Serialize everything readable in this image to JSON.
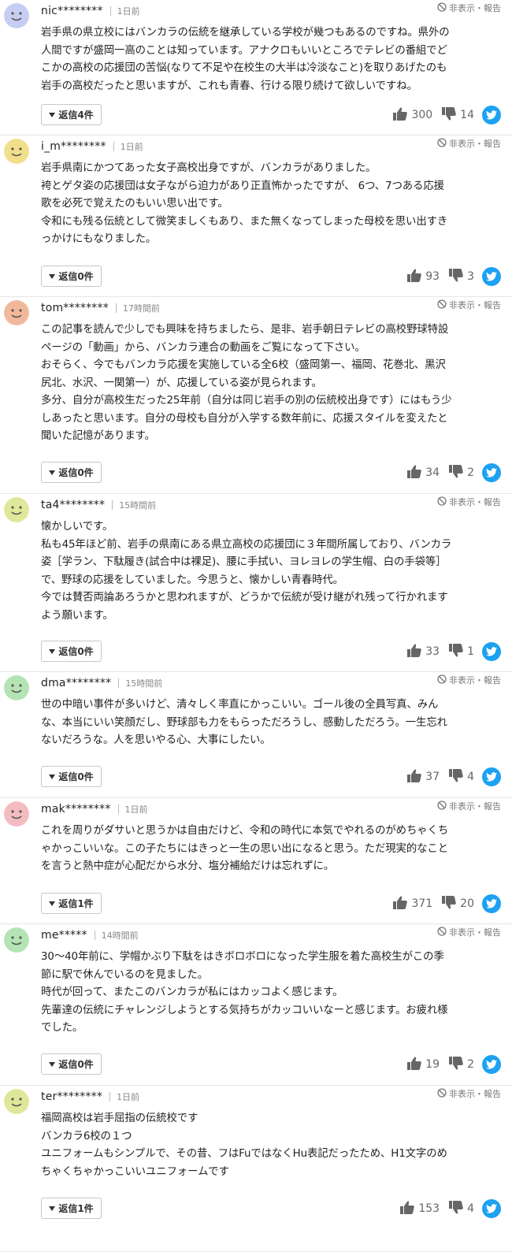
{
  "labels": {
    "hide": "非表示・報告"
  },
  "colors": {
    "twitter": "#1da1f2",
    "avatar_face": "#555555"
  },
  "comments": [
    {
      "user": "nic********",
      "time": "1日前",
      "avatar_color": "#c7cdf2",
      "body": "岩手県の県立校にはバンカラの伝統を継承している学校が幾つもあるのですね。県外の\n人間ですが盛岡一高のことは知っています。アナクロもいいところでテレビの番組でど\nこかの高校の応援団の苦悩(なりて不足や在校生の大半は冷淡なこと)を取りあげたのも\n岩手の高校だったと思いますが、これも青春、行ける限り続けて欲しいですね。",
      "replies": "返信4件",
      "likes": "300",
      "dislikes": "14"
    },
    {
      "user": "i_m********",
      "time": "1日前",
      "avatar_color": "#f2df8a",
      "body": "岩手県南にかつてあった女子高校出身ですが、バンカラがありました。\n袴とゲタ姿の応援団は女子ながら迫力があり正直怖かったですが、 6つ、7つある応援\n歌を必死で覚えたのもいい思い出です。\n令和にも残る伝統として微笑ましくもあり、また無くなってしまった母校を思い出すき\nっかけにもなりました。",
      "replies": "返信0件",
      "likes": "93",
      "dislikes": "3"
    },
    {
      "user": "tom********",
      "time": "17時間前",
      "avatar_color": "#f2b89c",
      "body": "この記事を読んで少しでも興味を持ちましたら、是非、岩手朝日テレビの高校野球特設\nページの「動画」から、バンカラ連合の動画をご覧になって下さい。\nおそらく、今でもバンカラ応援を実施している全6校（盛岡第一、福岡、花巻北、黒沢\n尻北、水沢、一関第一）が、応援している姿が見られます。\n多分、自分が高校生だった25年前（自分は同じ岩手の別の伝統校出身です）にはもう少\nしあったと思います。自分の母校も自分が入学する数年前に、応援スタイルを変えたと\n聞いた記憶があります。",
      "replies": "返信0件",
      "likes": "34",
      "dislikes": "2"
    },
    {
      "user": "ta4********",
      "time": "15時間前",
      "avatar_color": "#dfe89a",
      "body": "懐かしいです。\n私も45年ほど前、岩手の県南にある県立高校の応援団に３年間所属しており、バンカラ\n姿［学ラン、下駄履き(試合中は裸足)、腰に手拭い、ヨレヨレの学生帽、白の手袋等］\nで、野球の応援をしていました。今思うと、懐かしい青春時代。\n今では賛否両論あろうかと思われますが、どうかで伝統が受け継がれ残って行かれます\nよう願います。",
      "replies": "返信0件",
      "likes": "33",
      "dislikes": "1"
    },
    {
      "user": "dma********",
      "time": "15時間前",
      "avatar_color": "#b4e3b4",
      "body": "世の中暗い事件が多いけど、清々しく率直にかっこいい。ゴール後の全員写真、みん\nな、本当にいい笑顔だし、野球部も力をもらっただろうし、感動しただろう。一生忘れ\nないだろうな。人を思いやる心、大事にしたい。",
      "replies": "返信0件",
      "likes": "37",
      "dislikes": "4"
    },
    {
      "user": "mak********",
      "time": "1日前",
      "avatar_color": "#f2bcc0",
      "body": "これを周りがダサいと思うかは自由だけど、令和の時代に本気でやれるのがめちゃくち\nゃかっこいいな。この子たちにはきっと一生の思い出になると思う。ただ現実的なこと\nを言うと熱中症が心配だから水分、塩分補給だけは忘れずに。",
      "replies": "返信1件",
      "likes": "371",
      "dislikes": "20"
    },
    {
      "user": "me*****",
      "time": "14時間前",
      "avatar_color": "#b4e3b4",
      "body": "30〜40年前に、学帽かぶり下駄をはきボロボロになった学生服を着た高校生がこの季\n節に駅で休んでいるのを見ました。\n時代が回って、またこのバンカラが私にはカッコよく感じます。\n先輩達の伝統にチャレンジしようとする気持ちがカッコいいなーと感じます。お疲れ様\nでした。",
      "replies": "返信0件",
      "likes": "19",
      "dislikes": "2"
    },
    {
      "user": "ter********",
      "time": "1日前",
      "avatar_color": "#dfe89a",
      "body": "福岡高校は岩手屈指の伝統校です\nバンカラ6校の１つ\nユニフォームもシンプルで、その昔、フはFuではなくHu表記だったため、H1文字のめ\nちゃくちゃかっこいいユニフォームです",
      "replies": "返信1件",
      "likes": "153",
      "dislikes": "4"
    }
  ]
}
